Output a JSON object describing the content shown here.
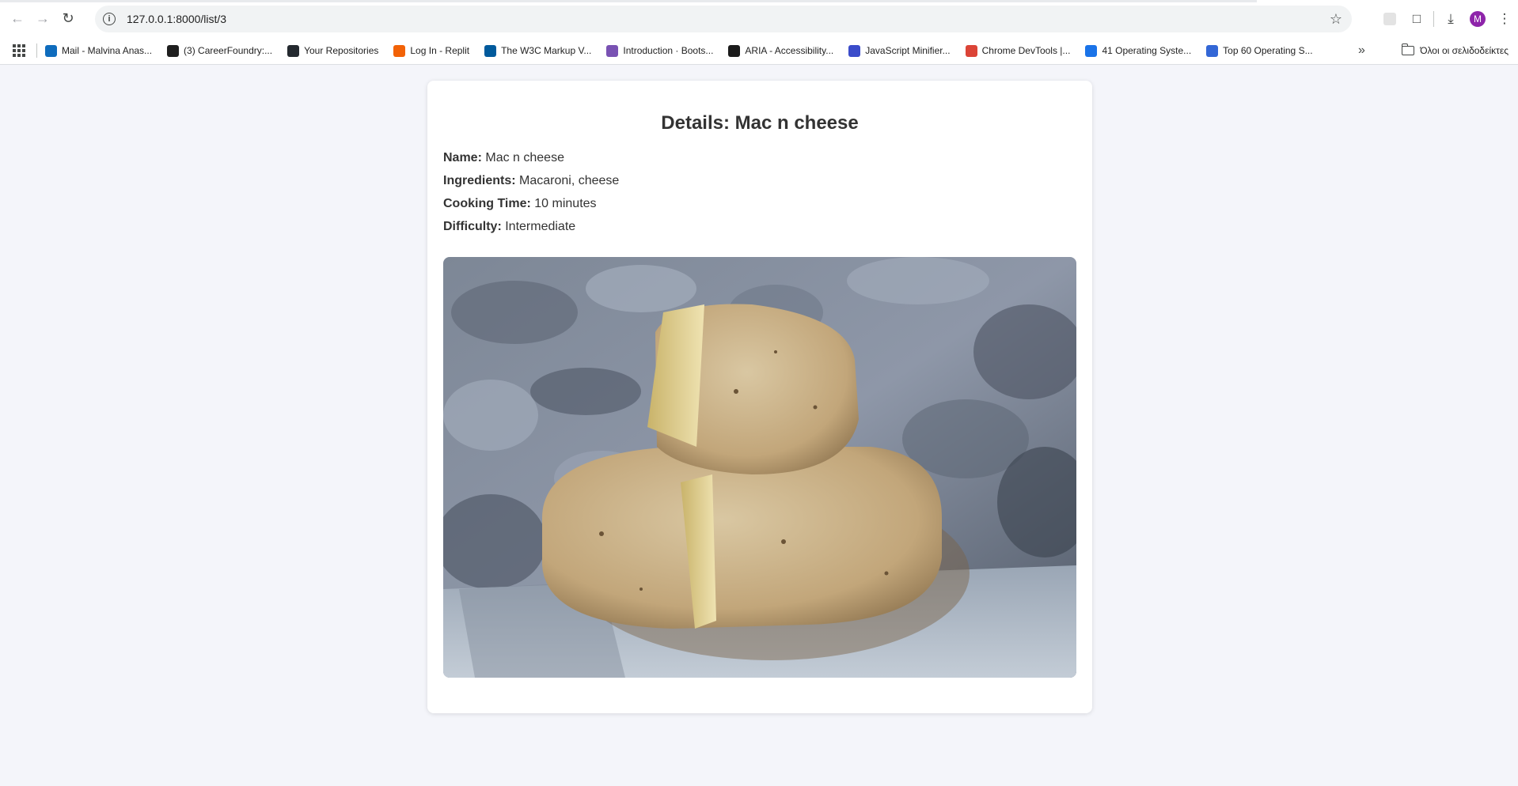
{
  "browser": {
    "url": "127.0.0.1:8000/list/3",
    "avatar_letter": "M",
    "bookmarks": [
      {
        "label": "Mail - Malvina Anas...",
        "icon": "outlook-icon",
        "color": "#0f6cbd"
      },
      {
        "label": "(3) CareerFoundry:...",
        "icon": "careerfoundry-icon",
        "color": "#1f1f1f"
      },
      {
        "label": "Your Repositories",
        "icon": "github-icon",
        "color": "#24292f"
      },
      {
        "label": "Log In - Replit",
        "icon": "replit-icon",
        "color": "#f26207"
      },
      {
        "label": "The W3C Markup V...",
        "icon": "w3c-icon",
        "color": "#005a9c"
      },
      {
        "label": "Introduction · Boots...",
        "icon": "bootstrap-icon",
        "color": "#7952b3"
      },
      {
        "label": "ARIA - Accessibility...",
        "icon": "mdn-icon",
        "color": "#1b1b1b"
      },
      {
        "label": "JavaScript Minifier...",
        "icon": "minifier-icon",
        "color": "#3b4cca"
      },
      {
        "label": "Chrome DevTools |...",
        "icon": "chrome-icon",
        "color": "#db4437"
      },
      {
        "label": "41 Operating Syste...",
        "icon": "info-icon",
        "color": "#1a73e8"
      },
      {
        "label": "Top 60 Operating S...",
        "icon": "globe-icon",
        "color": "#3367d6"
      }
    ],
    "all_bookmarks_label": "Όλοι οι σελιδοδείκτες"
  },
  "page": {
    "title": "Details: Mac n cheese",
    "name_label": "Name:",
    "name_value": "Mac n cheese",
    "ingredients_label": "Ingredients:",
    "ingredients_value": "Macaroni, cheese",
    "cooking_time_label": "Cooking Time:",
    "cooking_time_value": "10 minutes",
    "difficulty_label": "Difficulty:",
    "difficulty_value": "Intermediate"
  }
}
